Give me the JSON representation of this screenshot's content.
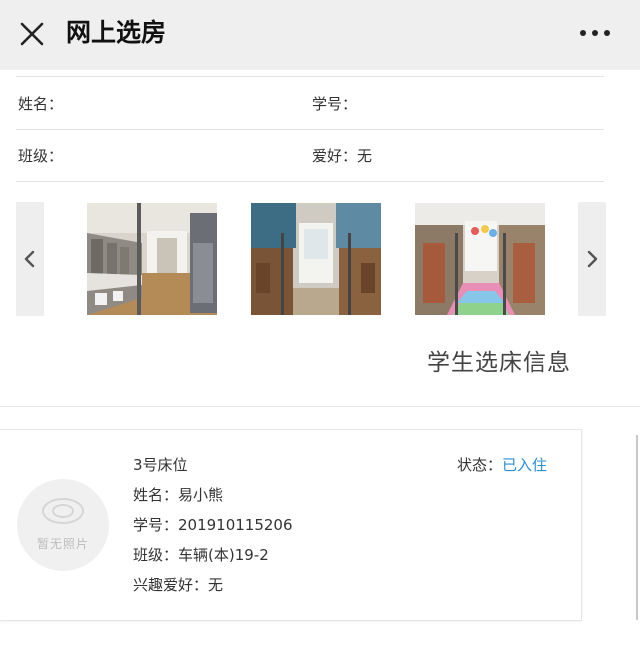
{
  "header": {
    "title": "网上选房"
  },
  "student": {
    "name_label": "姓名：",
    "id_label": "学号：",
    "class_label": "班级：",
    "hobby_label": "爱好：",
    "hobby_value": "无"
  },
  "section": {
    "title": "学生选床信息"
  },
  "bed": {
    "bed_label": "3号床位",
    "status_label": "状态：",
    "status_value": "已入住",
    "name_line": "姓名：易小熊",
    "id_line": "学号：201910115206",
    "class_line": "班级：车辆(本)19-2",
    "hobby_line": "兴趣爱好：无",
    "avatar_text": "暂无照片"
  },
  "colors": {
    "status_accent": "#2b8fd6",
    "topbar_bg": "#efefef"
  }
}
